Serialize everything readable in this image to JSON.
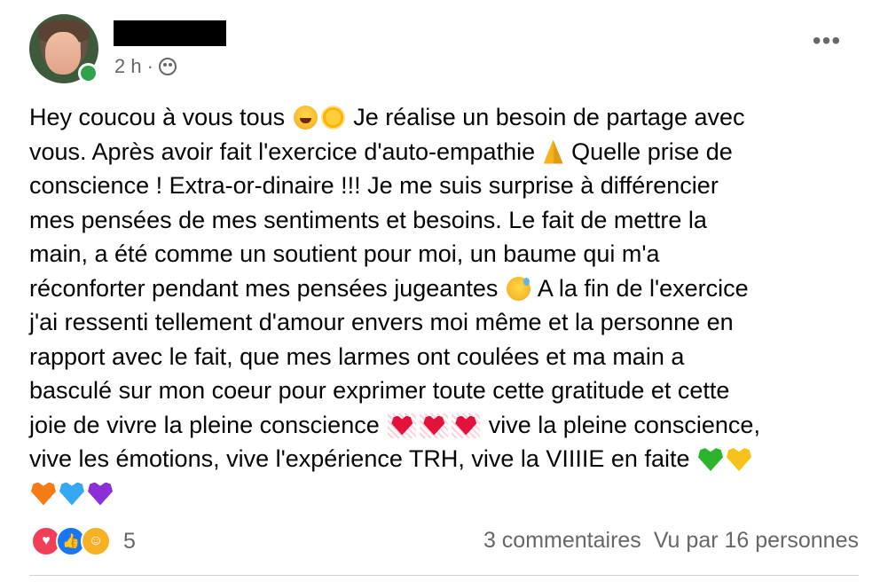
{
  "header": {
    "time": "2 h",
    "separator": "·",
    "privacy_icon": "friends-icon",
    "more_icon": "more-horizontal-icon",
    "more_label": "•••",
    "online_color": "#31a24c"
  },
  "post": {
    "lines": [
      "Hey coucou à vous tous",
      "Je réalise un besoin de partage avec",
      "vous. Après avoir fait l'exercice d'auto-empathie",
      "Quelle prise de",
      "conscience ! Extra-or-dinaire !!! Je me suis surprise à différencier",
      "mes pensées de mes sentiments et besoins. Le fait de mettre la",
      "main, a été comme un soutient pour moi, un baume qui m'a",
      "réconforter pendant mes pensées jugeantes",
      "A la fin de l'exercice",
      "j'ai ressenti tellement d'amour envers moi même et la personne en",
      "rapport avec le fait, que mes larmes ont coulées et ma main a",
      "basculé sur mon coeur pour exprimer toute cette gratitude et cette",
      "joie de vivre la pleine conscience",
      "vive la pleine conscience,",
      "vive les émotions, vive l'expérience TRH, vive la VIIIIE en faite"
    ],
    "text_color": "#050505"
  },
  "footer": {
    "reaction_icons": [
      "love-icon",
      "like-icon",
      "care-icon"
    ],
    "reaction_count": "5",
    "comments": "3 commentaires",
    "views": "Vu par 16 personnes",
    "muted_color": "#65676b"
  }
}
